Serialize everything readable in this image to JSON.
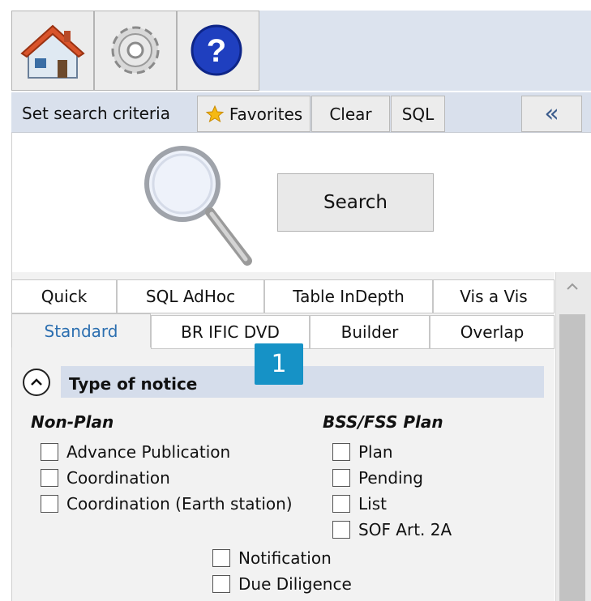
{
  "toolbar": {
    "buttons": [
      {
        "name": "home-icon"
      },
      {
        "name": "gear-icon"
      },
      {
        "name": "help-icon",
        "glyph": "?"
      }
    ]
  },
  "criteria_bar": {
    "title": "Set search criteria",
    "favorites": "Favorites",
    "clear": "Clear",
    "sql": "SQL",
    "collapse_glyph": "«"
  },
  "search": {
    "button_label": "Search",
    "icon": "magnifier-icon"
  },
  "tabs": {
    "row1": [
      "Quick",
      "SQL AdHoc",
      "Table InDepth",
      "Vis a Vis"
    ],
    "row2": [
      "Standard",
      "BR IFIC DVD",
      "Builder",
      "Overlap"
    ],
    "active": "Standard"
  },
  "badge": "1",
  "section": {
    "title": "Type of notice",
    "non_plan": {
      "title": "Non-Plan",
      "items": [
        "Advance Publication",
        "Coordination",
        "Coordination (Earth station)"
      ]
    },
    "plan": {
      "title": "BSS/FSS Plan",
      "items": [
        "Plan",
        "Pending",
        "List",
        "SOF Art. 2A"
      ]
    },
    "bottom_items": [
      "Notification",
      "Due Diligence"
    ]
  },
  "colors": {
    "toolbar_bg": "#dce3ee",
    "section_header_bg": "#d5ddeb",
    "badge_bg": "#1692c6",
    "active_tab_text": "#2c6fb0"
  }
}
